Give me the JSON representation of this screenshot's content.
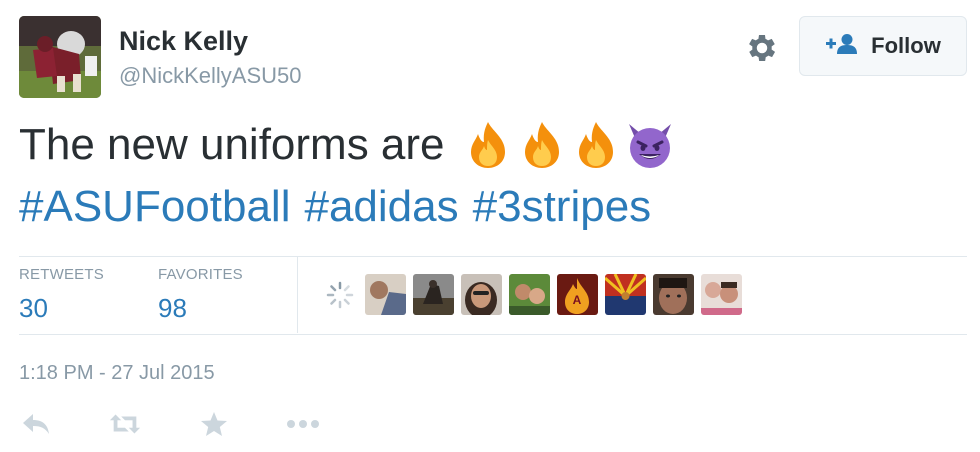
{
  "user": {
    "name": "Nick Kelly",
    "handle": "@NickKellyASU50",
    "avatar_icon": "football-player-photo"
  },
  "follow_button": {
    "label": "Follow",
    "icon": "add-user-icon"
  },
  "settings": {
    "icon": "gear-icon"
  },
  "tweet": {
    "text": "The new uniforms are",
    "emojis": [
      "fire-emoji",
      "fire-emoji",
      "fire-emoji",
      "smiling-devil-emoji"
    ],
    "hashtags": [
      "#ASUFootball",
      "#adidas",
      "#3stripes"
    ]
  },
  "stats": {
    "retweets_label": "RETWEETS",
    "retweets_value": "30",
    "favorites_label": "FAVORITES",
    "favorites_value": "98"
  },
  "favoriters": [
    "avatar-1",
    "avatar-2",
    "avatar-3",
    "avatar-4",
    "avatar-5",
    "avatar-6",
    "avatar-7",
    "avatar-8"
  ],
  "timestamp": "1:18 PM - 27 Jul 2015",
  "actions": [
    "reply-icon",
    "retweet-icon",
    "favorite-icon",
    "more-icon"
  ],
  "colors": {
    "link": "#2b7bb9",
    "muted": "#8899a6",
    "text": "#292f33",
    "divider": "#e1e8ed",
    "action_icon": "#ccd6dd"
  }
}
